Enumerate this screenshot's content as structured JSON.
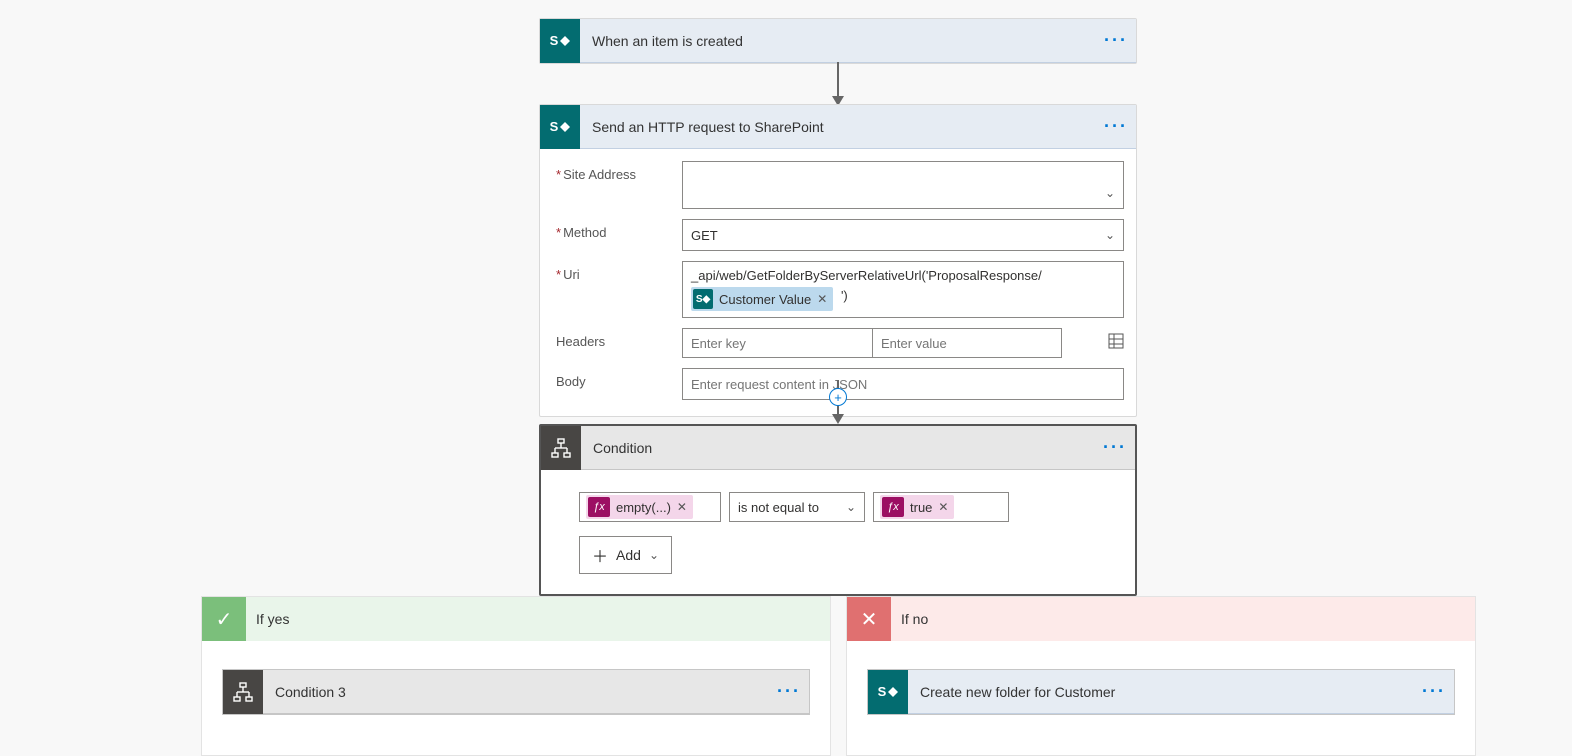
{
  "trigger": {
    "title": "When an item is created"
  },
  "httpStep": {
    "title": "Send an HTTP request to SharePoint",
    "labels": {
      "siteAddress": "Site Address",
      "method": "Method",
      "uri": "Uri",
      "headers": "Headers",
      "body": "Body"
    },
    "siteAddress": "",
    "method": "GET",
    "uri_text": "_api/web/GetFolderByServerRelativeUrl('ProposalResponse/",
    "uri_token": "Customer Value",
    "uri_suffix": "')",
    "headersKeyPlaceholder": "Enter key",
    "headersValuePlaceholder": "Enter value",
    "bodyPlaceholder": "Enter request content in JSON"
  },
  "condition": {
    "title": "Condition",
    "left_token": "empty(...)",
    "operator": "is not equal to",
    "right_token": "true",
    "addLabel": "Add"
  },
  "ifYes": {
    "title": "If yes",
    "child_title": "Condition 3"
  },
  "ifNo": {
    "title": "If no",
    "child_title": "Create new folder for Customer"
  }
}
